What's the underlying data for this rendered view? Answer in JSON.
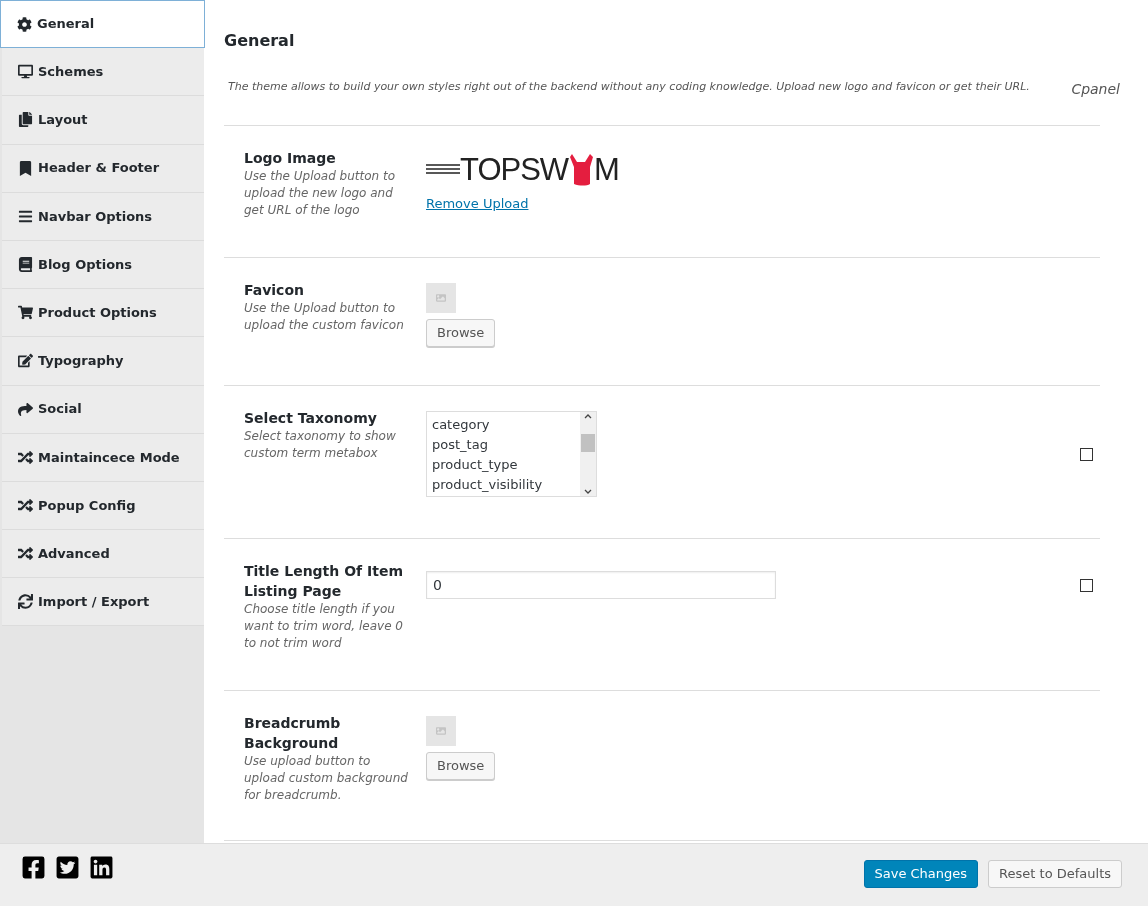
{
  "sidebar": {
    "items": [
      {
        "label": "General",
        "selected": true
      },
      {
        "label": "Schemes",
        "selected": false
      },
      {
        "label": "Layout",
        "selected": false
      },
      {
        "label": "Header & Footer",
        "selected": false
      },
      {
        "label": "Navbar Options",
        "selected": false
      },
      {
        "label": "Blog Options",
        "selected": false
      },
      {
        "label": "Product Options",
        "selected": false
      },
      {
        "label": "Typography",
        "selected": false
      },
      {
        "label": "Social",
        "selected": false
      },
      {
        "label": "Maintaincece Mode",
        "selected": false
      },
      {
        "label": "Popup Config",
        "selected": false
      },
      {
        "label": "Advanced",
        "selected": false
      },
      {
        "label": "Import / Export",
        "selected": false
      }
    ]
  },
  "section": {
    "title": "General",
    "description": "The theme allows to build your own styles right out of the backend without any coding knowledge. Upload new logo and favicon or get their URL.",
    "side_label": "Cpanel"
  },
  "fields": [
    {
      "kind": "logo",
      "title": "Logo Image",
      "help": "Use the Upload button to upload the new logo and get URL of the logo",
      "logo": {
        "left": "TOPSW",
        "right": "M"
      },
      "link": "Remove Upload"
    },
    {
      "kind": "upload",
      "title": "Favicon",
      "help": "Use the Upload button to upload the custom favicon",
      "button": "Browse"
    },
    {
      "kind": "multiselect",
      "title": "Select Taxonomy",
      "help": "Select taxonomy to show custom term metabox",
      "options": [
        "category",
        "post_tag",
        "product_type",
        "product_visibility"
      ],
      "checked": false
    },
    {
      "kind": "text",
      "title": "Title Length Of Item Listing Page",
      "help": "Choose title length if you want to trim word, leave 0 to not trim word",
      "value": "0",
      "checked": false
    },
    {
      "kind": "upload",
      "title": "Breadcrumb Background",
      "help": "Use upload button to upload custom background for breadcrumb.",
      "button": "Browse"
    }
  ],
  "footer": {
    "buttons": [
      {
        "label": "Save Changes",
        "kind": "primary"
      },
      {
        "label": "Reset to Defaults",
        "kind": "secondary"
      }
    ]
  }
}
